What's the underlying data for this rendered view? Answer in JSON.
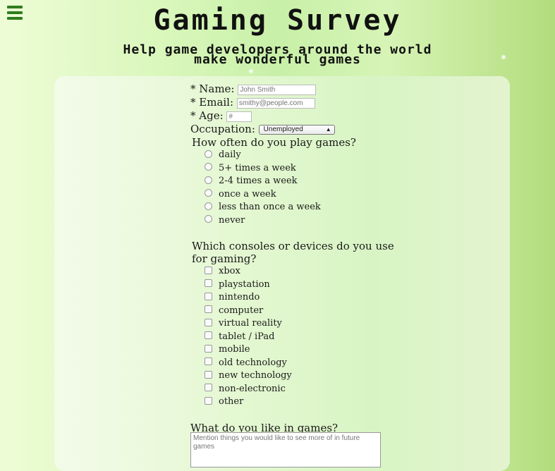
{
  "header": {
    "title": "Gaming Survey",
    "subtitle_line1": "Help game developers around the world",
    "subtitle_line2": "make wonderful games"
  },
  "form": {
    "name_label": "* Name:",
    "name_placeholder": "John Smith",
    "email_label": "* Email:",
    "email_placeholder": "smithy@people.com",
    "age_label": "* Age:",
    "age_placeholder": "#",
    "occupation_label": "Occupation:",
    "occupation_value": "Unemployed",
    "frequency_question": "How often do you play games?",
    "frequency_options": [
      "daily",
      "5+ times a week",
      "2-4 times a week",
      "once a week",
      "less than once a week",
      "never"
    ],
    "devices_question_line1": "Which consoles or devices do you use",
    "devices_question_line2": "for gaming?",
    "devices_options": [
      "xbox",
      "playstation",
      "nintendo",
      "computer",
      "virtual reality",
      "tablet / iPad",
      "mobile",
      "old technology",
      "new technology",
      "non-electronic",
      "other"
    ],
    "likes_question": "What do you like in games?",
    "likes_placeholder": "Mention things you would like to see more of in future games"
  },
  "colors": {
    "accent": "#2e7d1f",
    "background_left": "#eefcd6",
    "background_right": "#b3dc7c"
  },
  "icons": {
    "menu": "hamburger-menu-icon"
  }
}
